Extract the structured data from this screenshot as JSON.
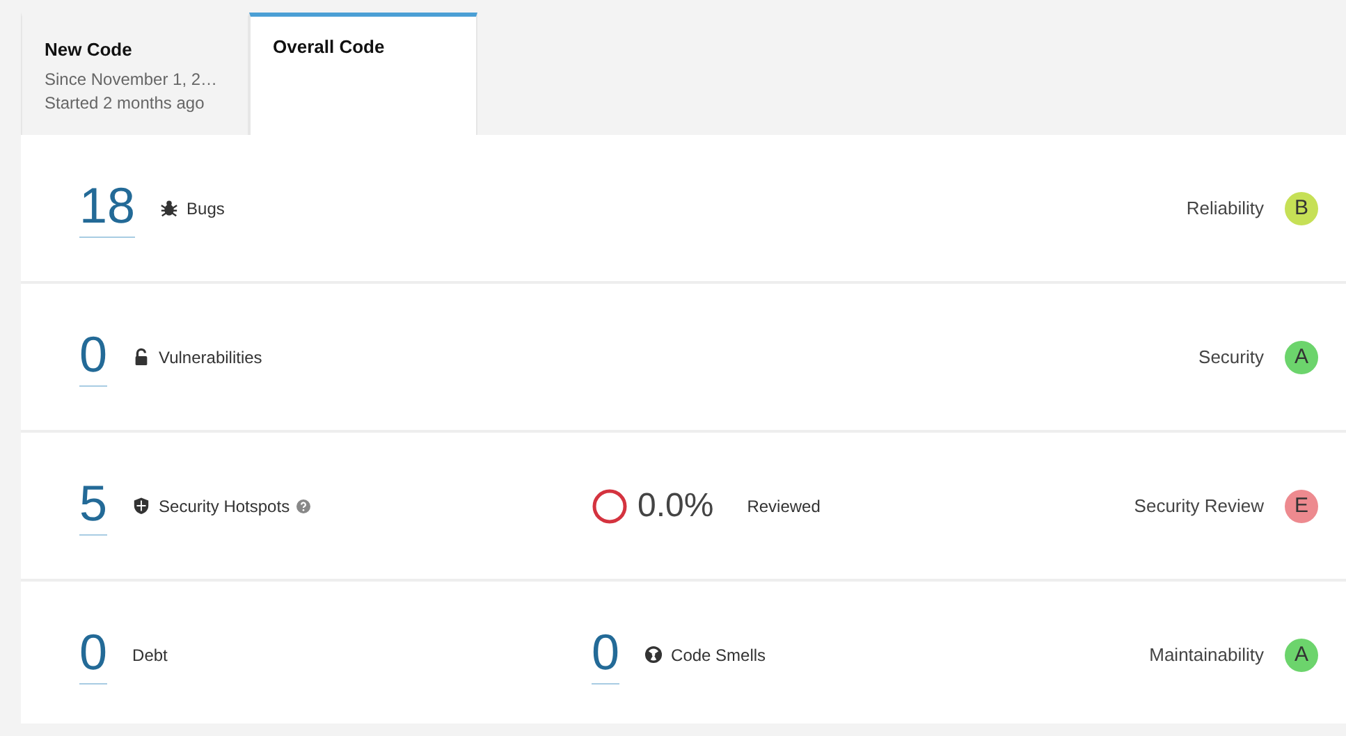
{
  "tabs": [
    {
      "title": "New Code",
      "lines": [
        "Since November 1, 2…",
        "Started 2 months ago"
      ],
      "selected": false
    },
    {
      "title": "Overall Code",
      "selected": true
    }
  ],
  "rows": [
    {
      "kind": "bugs",
      "value": "18",
      "label": "Bugs",
      "help": false,
      "rating_label": "Reliability",
      "rating": "B",
      "color": "#c6e056"
    },
    {
      "kind": "vulnerabilities",
      "value": "0",
      "label": "Vulnerabilities",
      "help": false,
      "rating_label": "Security",
      "rating": "A",
      "color": "#6cd46c"
    },
    {
      "kind": "hotspots",
      "value": "5",
      "label": "Security Hotspots",
      "help": true,
      "middle": {
        "kind": "review",
        "value": "0.0%",
        "label": "Reviewed"
      },
      "rating_label": "Security Review",
      "rating": "E",
      "color": "#ed8a8f"
    },
    {
      "kind": "debt",
      "value": "0",
      "label": "Debt",
      "help": false,
      "middle": {
        "kind": "smells",
        "value": "0",
        "label": "Code Smells"
      },
      "rating_label": "Maintainability",
      "rating": "A",
      "color": "#6cd46c"
    }
  ]
}
